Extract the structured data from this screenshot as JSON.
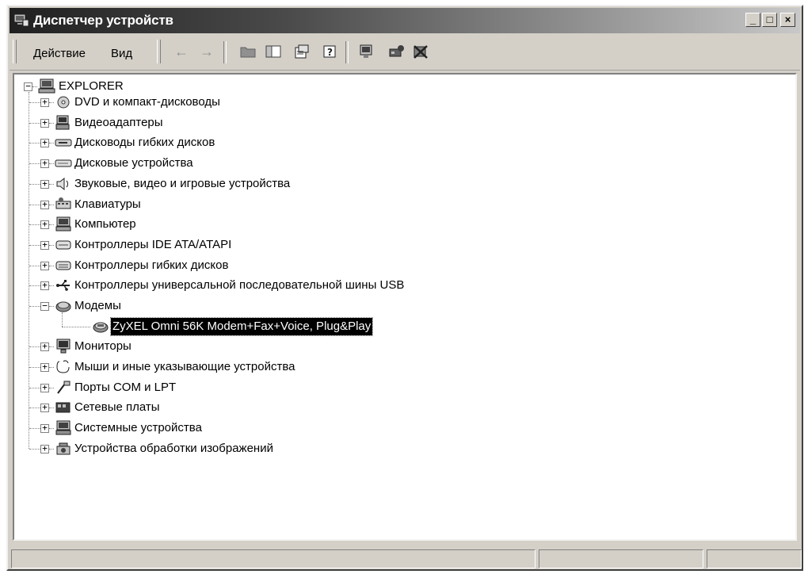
{
  "window": {
    "title": "Диспетчер устройств",
    "buttons": {
      "minimize": "_",
      "maximize": "□",
      "close": "×"
    }
  },
  "toolbar": {
    "menu": [
      "Действие",
      "Вид"
    ],
    "nav": {
      "back": "←",
      "forward": "→"
    }
  },
  "tree": {
    "root": "EXPLORER",
    "items": [
      {
        "label": "DVD и компакт-дисководы",
        "icon": "cdrom-icon",
        "expander": "+"
      },
      {
        "label": "Видеоадаптеры",
        "icon": "display-adapter-icon",
        "expander": "+"
      },
      {
        "label": "Дисководы гибких дисков",
        "icon": "floppy-drive-icon",
        "expander": "+"
      },
      {
        "label": "Дисковые устройства",
        "icon": "disk-drive-icon",
        "expander": "+"
      },
      {
        "label": "Звуковые, видео и игровые устройства",
        "icon": "sound-icon",
        "expander": "+"
      },
      {
        "label": "Клавиатуры",
        "icon": "keyboard-icon",
        "expander": "+"
      },
      {
        "label": "Компьютер",
        "icon": "computer-icon",
        "expander": "+"
      },
      {
        "label": "Контроллеры IDE ATA/ATAPI",
        "icon": "ide-controller-icon",
        "expander": "+"
      },
      {
        "label": "Контроллеры гибких дисков",
        "icon": "floppy-controller-icon",
        "expander": "+"
      },
      {
        "label": "Контроллеры универсальной последовательной шины USB",
        "icon": "usb-icon",
        "expander": "+"
      },
      {
        "label": "Модемы",
        "icon": "modem-icon",
        "expander": "−",
        "children": [
          {
            "label": "ZyXEL Omni 56K Modem+Fax+Voice, Plug&Play",
            "icon": "modem-device-icon",
            "selected": true
          }
        ]
      },
      {
        "label": "Мониторы",
        "icon": "monitor-icon",
        "expander": "+"
      },
      {
        "label": "Мыши и иные указывающие устройства",
        "icon": "mouse-icon",
        "expander": "+"
      },
      {
        "label": "Порты COM и LPT",
        "icon": "port-icon",
        "expander": "+"
      },
      {
        "label": "Сетевые платы",
        "icon": "network-card-icon",
        "expander": "+"
      },
      {
        "label": "Системные устройства",
        "icon": "system-device-icon",
        "expander": "+"
      },
      {
        "label": "Устройства обработки изображений",
        "icon": "imaging-device-icon",
        "expander": "+"
      }
    ]
  }
}
